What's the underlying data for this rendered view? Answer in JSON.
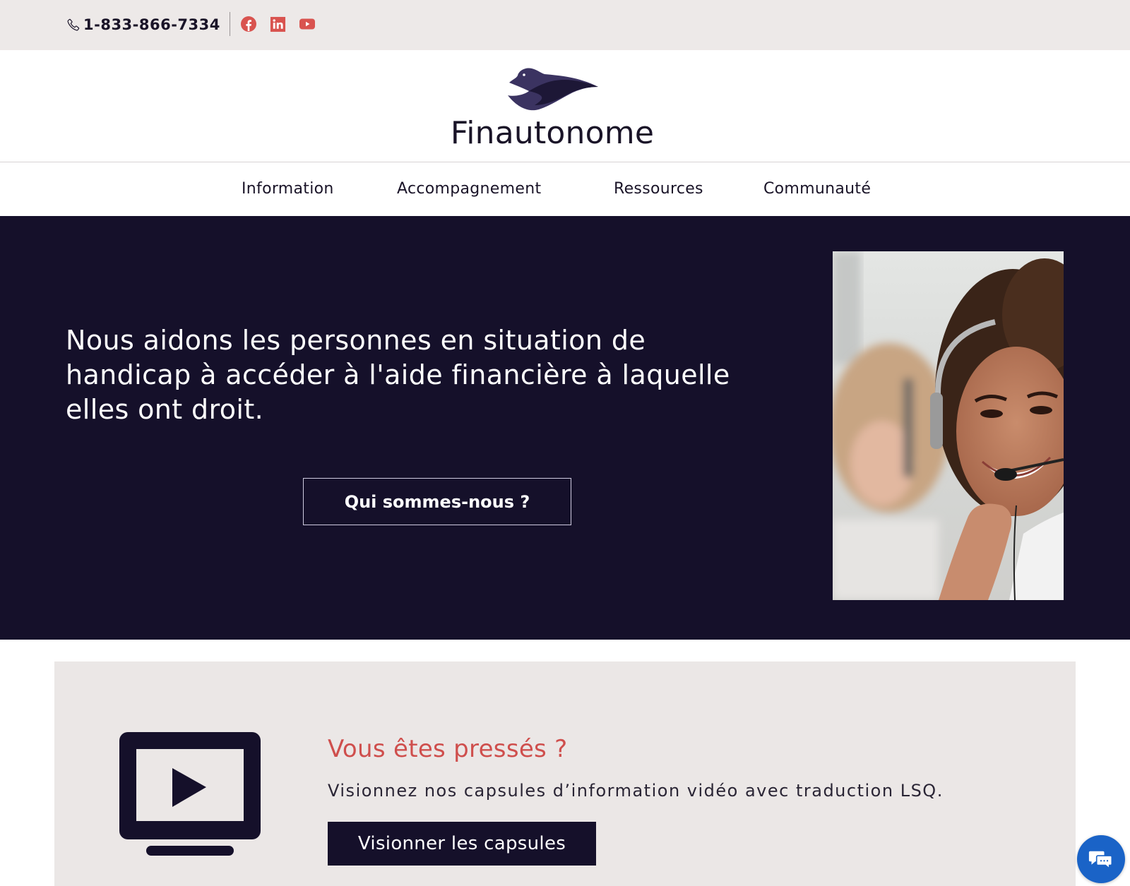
{
  "topbar": {
    "phone": "1-833-866-7334",
    "phone_icon": "phone-icon",
    "social": [
      {
        "name": "facebook",
        "icon": "facebook-icon",
        "color": "#d9534f"
      },
      {
        "name": "linkedin",
        "icon": "linkedin-icon",
        "color": "#d9534f"
      },
      {
        "name": "youtube",
        "icon": "youtube-icon",
        "color": "#d9534f"
      }
    ]
  },
  "brand": {
    "name": "Finautonome",
    "logo_icon": "bird-logo-icon",
    "color": "#1a1428"
  },
  "nav": {
    "items": [
      {
        "label": "Information"
      },
      {
        "label": "Accompagnement"
      },
      {
        "label": "Ressources"
      },
      {
        "label": "Communauté"
      }
    ]
  },
  "hero": {
    "headline": "Nous aidons les personnes en situation de handicap à accéder à l'aide financière à laquelle elles ont droit.",
    "cta_label": "Qui sommes-nous ?",
    "background_color": "#15102a",
    "image_alt": "Smiling customer service agent wearing a headset"
  },
  "video_card": {
    "icon": "video-screen-icon",
    "title": "Vous êtes pressés ?",
    "description": "Visionnez nos capsules d’information vidéo avec traduction LSQ.",
    "cta_label": "Visionner les capsules",
    "title_color": "#cf4f4d"
  },
  "chat": {
    "icon": "chat-bubbles-icon",
    "color": "#1a63c7"
  }
}
